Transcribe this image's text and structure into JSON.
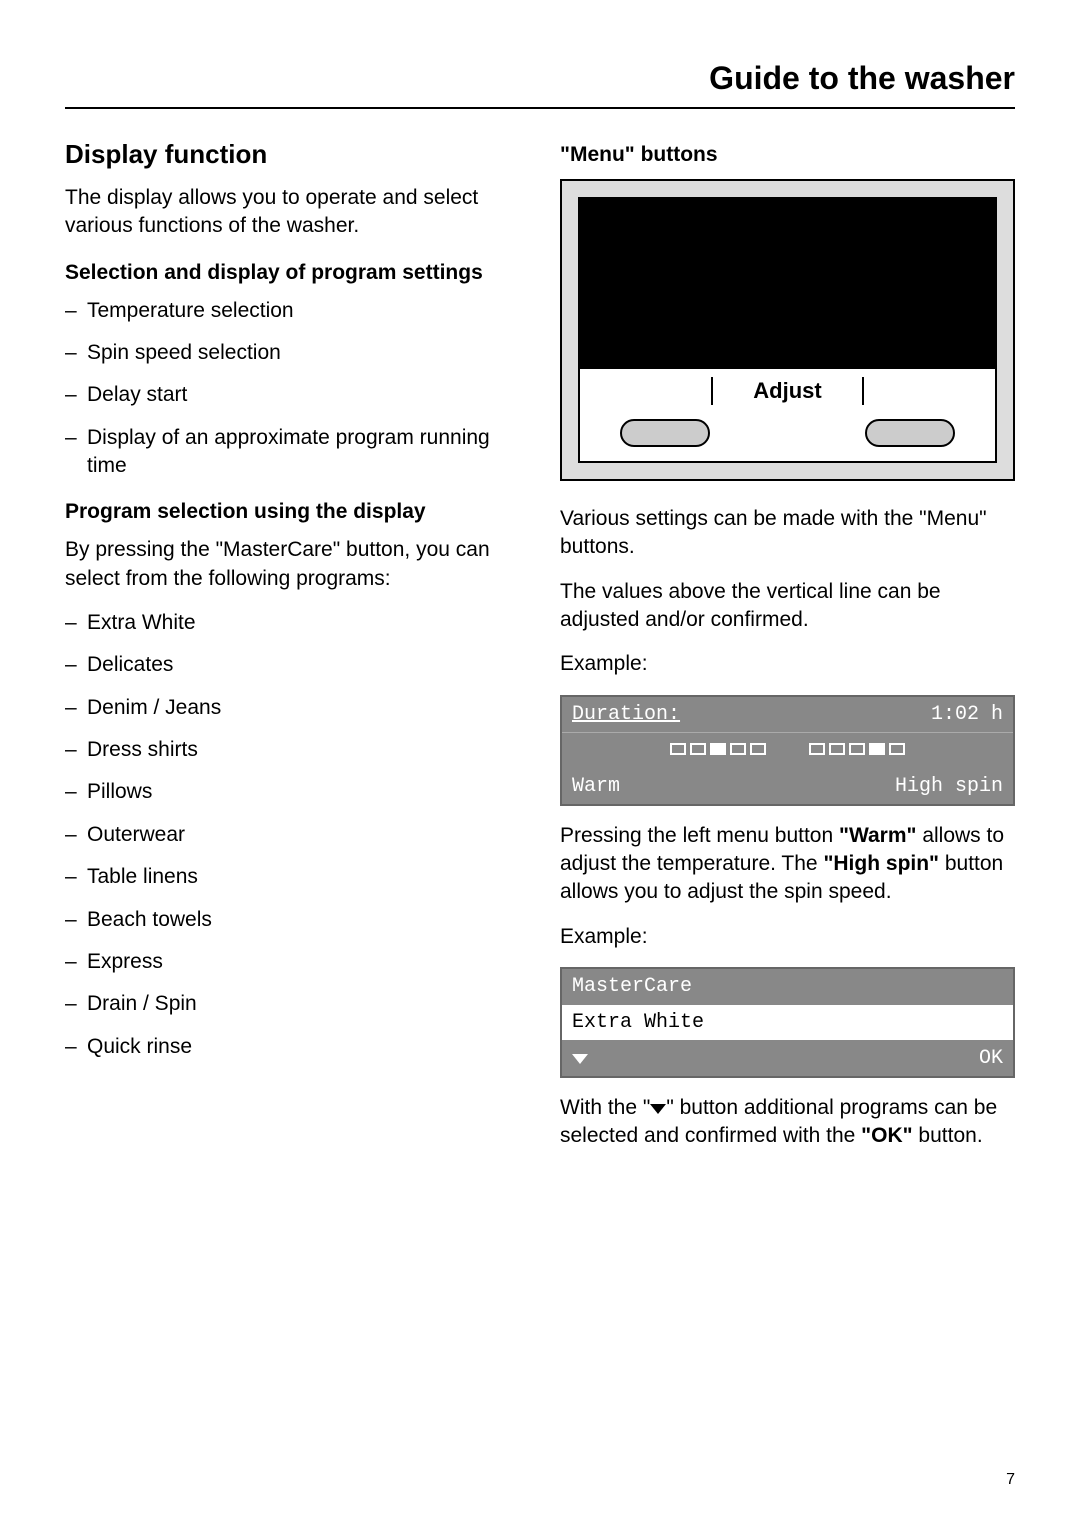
{
  "header": {
    "title": "Guide to the washer"
  },
  "left": {
    "heading": "Display function",
    "intro": "The display allows you to operate and select various functions of the washer.",
    "sub1": "Selection and display of program settings",
    "list1": [
      "Temperature selection",
      "Spin speed selection",
      "Delay start",
      "Display of an approximate program running time"
    ],
    "sub2": "Program selection using the display",
    "p2": "By pressing the \"MasterCare\" button, you can select from the following programs:",
    "list2": [
      "Extra White",
      "Delicates",
      "Denim / Jeans",
      "Dress shirts",
      "Pillows",
      "Outerwear",
      "Table linens",
      "Beach towels",
      "Express",
      "Drain / Spin",
      "Quick rinse"
    ]
  },
  "right": {
    "sub1": "\"Menu\" buttons",
    "adjust_label": "Adjust",
    "p1": "Various settings can be made with the \"Menu\" buttons.",
    "p2": "The values above the vertical line can be adjusted and/or confirmed.",
    "example_label": "Example:",
    "lcd1": {
      "duration_label": "Duration:",
      "duration_value": "1:02 h",
      "bottom_left": "Warm",
      "bottom_right": "High spin"
    },
    "p3_pre": "Pressing the left menu button ",
    "p3_b1": "\"Warm\"",
    "p3_mid": " allows to adjust the temperature.  The ",
    "p3_b2": "\"High spin\"",
    "p3_post": " button allows you to adjust the spin speed.",
    "lcd2": {
      "r1": "MasterCare",
      "r2": "Extra White",
      "r3_right": "OK"
    },
    "p4_pre": "With the \"",
    "p4_post": "\" button additional programs can be selected and confirmed with the ",
    "p4_b": "\"OK\"",
    "p4_end": " button."
  },
  "page_number": "7"
}
